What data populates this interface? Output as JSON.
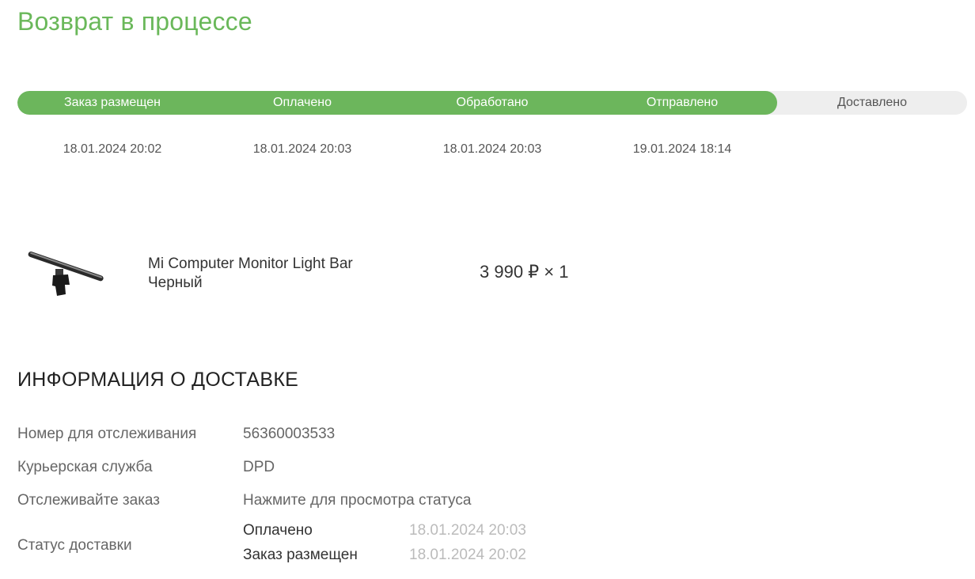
{
  "header": {
    "title": "Возврат в процессе"
  },
  "progress": {
    "completed_fraction": 0.8,
    "colors": {
      "done": "#6cb65c",
      "pending": "#eeeeee",
      "title": "#6ab85a"
    },
    "steps": [
      {
        "label": "Заказ размещен",
        "date": "18.01.2024 20:02",
        "done": true
      },
      {
        "label": "Оплачено",
        "date": "18.01.2024 20:03",
        "done": true
      },
      {
        "label": "Обработано",
        "date": "18.01.2024 20:03",
        "done": true
      },
      {
        "label": "Отправлено",
        "date": "19.01.2024 18:14",
        "done": true
      },
      {
        "label": "Доставлено",
        "date": "",
        "done": false
      }
    ]
  },
  "product": {
    "name": "Mi Computer Monitor Light Bar",
    "variant": "Черный",
    "price": "3 990 ₽ × 1",
    "image_icon": "monitor-light-bar-image"
  },
  "delivery": {
    "section_title": "ИНФОРМАЦИЯ О ДОСТАВКЕ",
    "tracking_label": "Номер для отслеживания",
    "tracking_value": "56360003533",
    "courier_label": "Курьерская служба",
    "courier_value": "DPD",
    "track_label": "Отслеживайте заказ",
    "track_link": "Нажмите для просмотра статуса",
    "status_label": "Статус доставки",
    "status_history": [
      {
        "status": "Оплачено",
        "date": "18.01.2024 20:03"
      },
      {
        "status": "Заказ размещен",
        "date": "18.01.2024 20:02"
      }
    ]
  }
}
